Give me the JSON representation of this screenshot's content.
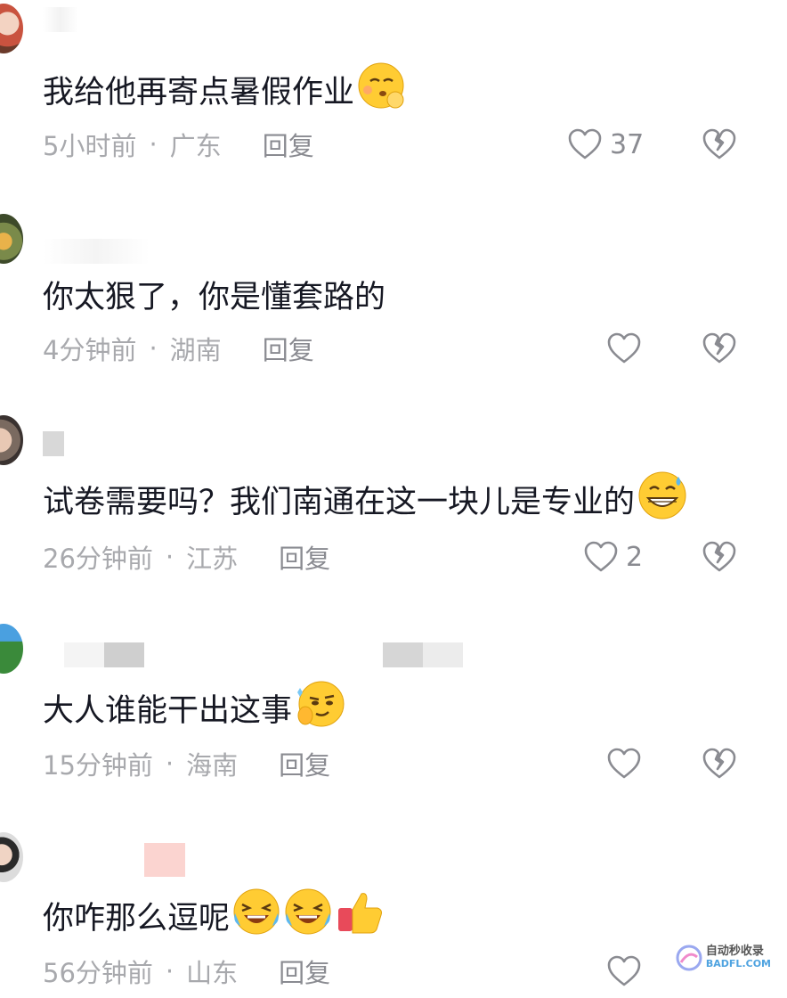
{
  "comments": [
    {
      "text": "我给他再寄点暑假作业",
      "time": "5小时前",
      "separator": "·",
      "location": "广东",
      "reply_label": "回复",
      "like_count": "37",
      "emojis": [
        "shushing-face-emoji"
      ]
    },
    {
      "text": "你太狠了，你是懂套路的",
      "time": "4分钟前",
      "separator": "·",
      "location": "湖南",
      "reply_label": "回复",
      "like_count": "",
      "emojis": []
    },
    {
      "text": "试卷需要吗？我们南通在这一块儿是专业的",
      "time": "26分钟前",
      "separator": "·",
      "location": "江苏",
      "reply_label": "回复",
      "like_count": "2",
      "emojis": [
        "grinning-sweat-emoji"
      ]
    },
    {
      "text": "大人谁能干出这事",
      "time": "15分钟前",
      "separator": "·",
      "location": "海南",
      "reply_label": "回复",
      "like_count": "",
      "emojis": [
        "smug-face-emoji"
      ]
    },
    {
      "text": "你咋那么逗呢",
      "time": "56分钟前",
      "separator": "·",
      "location": "山东",
      "reply_label": "回复",
      "like_count": "",
      "emojis": [
        "rolling-laughing-emoji",
        "rolling-laughing-emoji",
        "thumbs-up-emoji"
      ]
    }
  ],
  "watermark": {
    "line1": "自动秒收录",
    "line2": "BADFL.COM"
  },
  "colors": {
    "text": "#161823",
    "meta": "#a8a9ad",
    "icon": "#8a8b91",
    "emoji_face": "#ffcc33"
  }
}
